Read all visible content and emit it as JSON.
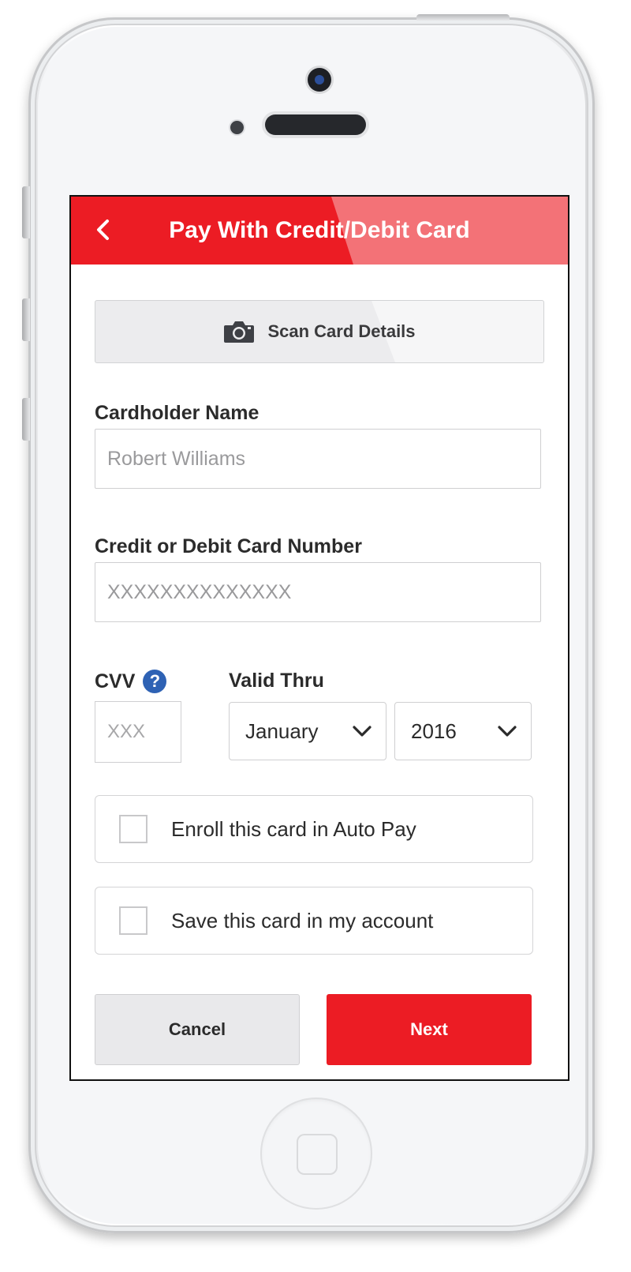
{
  "header": {
    "back_icon": "chevron-left-icon",
    "title": "Pay With Credit/Debit Card"
  },
  "scan": {
    "icon": "camera-icon",
    "label": "Scan Card Details"
  },
  "cardholder": {
    "label": "Cardholder Name",
    "value": "Robert Williams"
  },
  "card_number": {
    "label": "Credit or Debit Card Number",
    "placeholder": "XXXXXXXXXXXXXX"
  },
  "cvv": {
    "label": "CVV",
    "help_icon": "question-icon",
    "help_glyph": "?",
    "placeholder": "XXX"
  },
  "valid_thru": {
    "label": "Valid Thru",
    "month": "January",
    "year": "2016"
  },
  "options": [
    {
      "label": "Enroll this card in Auto Pay",
      "checked": false
    },
    {
      "label": "Save this card in my account",
      "checked": false
    }
  ],
  "actions": {
    "cancel": "Cancel",
    "next": "Next"
  },
  "colors": {
    "brand_red": "#ec1c24",
    "help_blue": "#2e62b4"
  }
}
